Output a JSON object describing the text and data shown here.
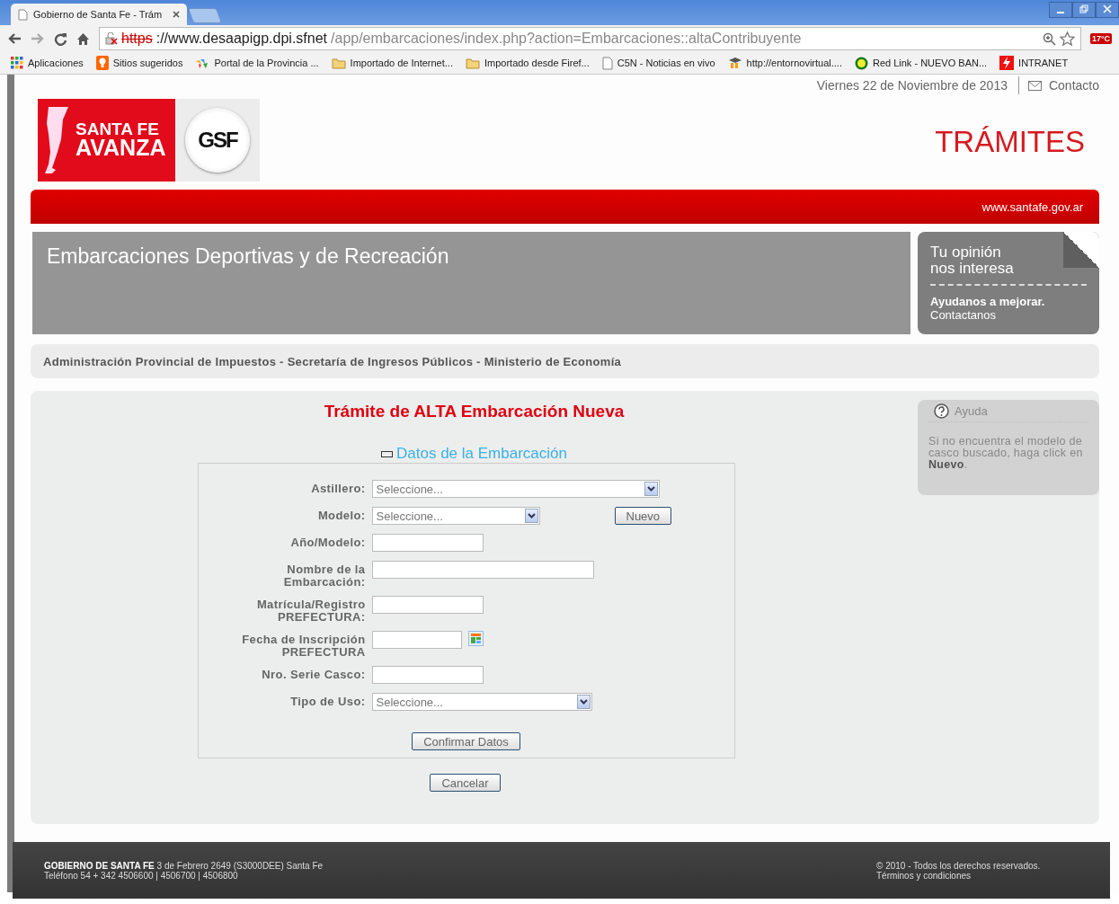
{
  "browser": {
    "tab_title": "Gobierno de Santa Fe - Trám",
    "url_scheme": "https",
    "url_host": "://www.desaapigp.dpi.sfnet",
    "url_path": "/app/embarcaciones/index.php?action=Embarcaciones::altaContribuyente",
    "weather": "17°C",
    "bookmarks": [
      {
        "kind": "apps",
        "label": "Aplicaciones"
      },
      {
        "kind": "suggest",
        "label": "Sitios sugeridos"
      },
      {
        "kind": "portal",
        "label": "Portal de la Provincia ..."
      },
      {
        "kind": "folder",
        "label": "Importado de Internet..."
      },
      {
        "kind": "folder",
        "label": "Importado desde Firef..."
      },
      {
        "kind": "page",
        "label": "C5N - Noticias en vivo"
      },
      {
        "kind": "moodle",
        "label": "http://entornovirtual...."
      },
      {
        "kind": "link",
        "label": "Red Link - NUEVO BAN..."
      },
      {
        "kind": "intranet",
        "label": "INTRANET"
      }
    ]
  },
  "header": {
    "date": "Viernes 22 de Noviembre de 2013",
    "contact": "Contacto",
    "logo_line1": "SANTA FE",
    "logo_line2": "AVANZA",
    "badge": "GSF",
    "section": "TRÁMITES",
    "site": "www.santafe.gov.ar"
  },
  "banner": {
    "title": "Embarcaciones Deportivas y de Recreación",
    "opinion_line1": "Tu opinión",
    "opinion_line2": "nos interesa",
    "opinion_bold": "Ayudanos a mejorar.",
    "opinion_link": "Contactanos"
  },
  "breadcrumb": "Administración Provincial de Impuestos - Secretaría de Ingresos Públicos - Ministerio de Economía",
  "form": {
    "title": "Trámite de ALTA Embarcación Nueva",
    "section": "Datos de la Embarcación",
    "expanded": true,
    "fields": [
      {
        "kind": "select",
        "label": "Astillero:",
        "placeholder": "Seleccione..."
      },
      {
        "kind": "select",
        "label": "Modelo:",
        "placeholder": "Seleccione...",
        "button": "Nuevo"
      },
      {
        "kind": "text",
        "label": "Año/Modelo:"
      },
      {
        "kind": "text",
        "label": "Nombre de la Embarcación:"
      },
      {
        "kind": "text",
        "label": "Matrícula/Registro PREFECTURA:"
      },
      {
        "kind": "date",
        "label": "Fecha de Inscripción PREFECTURA"
      },
      {
        "kind": "text",
        "label": "Nro. Serie Casco:"
      },
      {
        "kind": "select",
        "label": "Tipo de Uso:",
        "placeholder": "Seleccione..."
      }
    ],
    "confirm": "Confirmar Datos",
    "cancel": "Cancelar"
  },
  "help": {
    "title": "Ayuda",
    "text": "Si no encuentra el modelo de casco buscado, haga click en **Nuevo**."
  },
  "footer": {
    "address": "**GOBIERNO DE SANTA FE** 3 de Febrero 2649 (S3000DEE) Santa Fe",
    "phone": "Teléfono 54 + 342 4506600 | 4506700 | 4506800",
    "copyright": "© 2010 - Todos los derechos reservados.",
    "terms": "Términos y condiciones"
  }
}
